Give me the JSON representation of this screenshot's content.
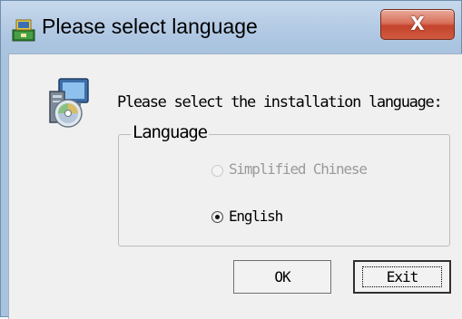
{
  "window": {
    "title": "Please select language",
    "close_glyph": "X"
  },
  "prompt": "Please select the installation language:",
  "language_group": {
    "label": "Language",
    "options": [
      {
        "label": "Simplified Chinese",
        "enabled": false,
        "selected": false
      },
      {
        "label": "English",
        "enabled": true,
        "selected": true
      }
    ]
  },
  "buttons": {
    "ok_label": "OK",
    "exit_label": "Exit"
  },
  "icons": {
    "app": "installer-app-icon",
    "setup": "setup-computer-disc-icon",
    "close": "close-icon"
  },
  "colors": {
    "close_button": "#d0503a",
    "title_bar": "#b9cee6",
    "client_background": "#f0f0f0",
    "disabled_text": "#9a9a9a"
  }
}
